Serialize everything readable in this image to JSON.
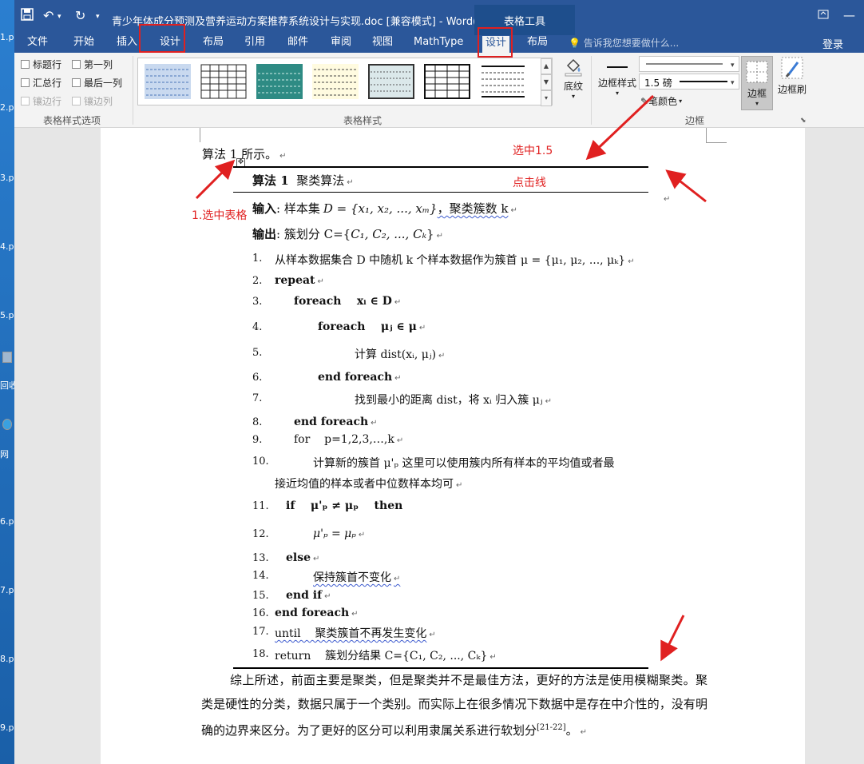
{
  "desktop": {
    "labels": [
      "1.p",
      "2.p",
      "3.p",
      "4.p",
      "5.p",
      "回收",
      "网",
      "6.p",
      "7.p",
      "8.p",
      "9.p"
    ]
  },
  "titlebar": {
    "title": "青少年体成分预测及营养运动方案推荐系统设计与实现.doc [兼容模式] - Word(...",
    "context_group": "表格工具",
    "icons": [
      "save-icon",
      "undo-icon",
      "redo-icon",
      "customize-icon",
      "restore-icon",
      "minimize-icon"
    ]
  },
  "tabs": [
    {
      "label": "文件"
    },
    {
      "label": "开始"
    },
    {
      "label": "插入"
    },
    {
      "label": "设计"
    },
    {
      "label": "布局"
    },
    {
      "label": "引用"
    },
    {
      "label": "邮件"
    },
    {
      "label": "审阅"
    },
    {
      "label": "视图"
    },
    {
      "label": "MathType"
    },
    {
      "label": "设计"
    },
    {
      "label": "布局"
    }
  ],
  "tell_me": "告诉我您想要做什么...",
  "login": "登录",
  "ribbon": {
    "style_options": {
      "label": "表格样式选项",
      "items": [
        {
          "label": "标题行",
          "enabled": true
        },
        {
          "label": "第一列",
          "enabled": true
        },
        {
          "label": "汇总行",
          "enabled": true
        },
        {
          "label": "最后一列",
          "enabled": true
        },
        {
          "label": "镶边行",
          "enabled": false
        },
        {
          "label": "镶边列",
          "enabled": false
        }
      ]
    },
    "table_styles": {
      "label": "表格样式"
    },
    "shading": {
      "label": "底纹"
    },
    "borders_group": {
      "label": "边框",
      "border_styles_label": "边框样式",
      "weight_value": "1.5 磅",
      "pen_color_label": "笔颜色",
      "borders_label": "边框",
      "border_painter_label": "边框刷"
    }
  },
  "annotations": {
    "select_table": "1.选中表格",
    "select_15": "选中1.5",
    "click_line": "点击线"
  },
  "document": {
    "intro_line": "算法 1 所示。",
    "algo_title": {
      "num": "算法 1",
      "name": "聚类算法"
    },
    "input": {
      "label": "输入",
      "text": ": 样本集",
      "math": "D = {x₁, x₂, ..., xₘ}",
      "tail": "，聚类簇数 k"
    },
    "output": {
      "label": "输出",
      "text": ": 簇划分 C={",
      "math": "C₁, C₂, ..., Cₖ",
      "tail": "}"
    },
    "steps": [
      {
        "n": "1.",
        "text": "从样本数据集合 D 中随机 k 个样本数据作为簇首 μ = {μ₁, μ₂, ..., μₖ}"
      },
      {
        "n": "2.",
        "text": "repeat"
      },
      {
        "n": "3.",
        "text": "foreach    xᵢ ∈ D"
      },
      {
        "n": "4.",
        "text": "foreach    μⱼ ∈ μ"
      },
      {
        "n": "5.",
        "text": "计算 dist(xᵢ, μⱼ)"
      },
      {
        "n": "6.",
        "text": "end foreach"
      },
      {
        "n": "7.",
        "text": "找到最小的距离 dist，将 xᵢ 归入簇 μⱼ"
      },
      {
        "n": "8.",
        "text": "end foreach"
      },
      {
        "n": "9.",
        "text": "for    p=1,2,3,…,k"
      },
      {
        "n": "10.",
        "text": "计算新的簇首 μ'ₚ 这里可以使用簇内所有样本的平均值或者最"
      },
      {
        "n": "",
        "text": "接近均值的样本或者中位数样本均可"
      },
      {
        "n": "11.",
        "text": "if    μ'ₚ ≠ μₚ    then"
      },
      {
        "n": "12.",
        "text": "μ'ₚ = μₚ"
      },
      {
        "n": "13.",
        "text": "else"
      },
      {
        "n": "14.",
        "text": "保持簇首不变化"
      },
      {
        "n": "15.",
        "text": "end if"
      },
      {
        "n": "16.",
        "text": "end foreach"
      },
      {
        "n": "17.",
        "text": "until    聚类簇首不再发生变化"
      },
      {
        "n": "18.",
        "text": "return    簇划分结果 C={C₁, C₂, ..., Cₖ}"
      }
    ],
    "body_paragraph": "综上所述，前面主要是聚类，但是聚类并不是最佳方法，更好的方法是使用模糊聚类。聚类是硬性的分类，数据只属于一个类别。而实际上在很多情况下数据中是存在中介性的，没有明确的边界来区分。为了更好的区分可以利用隶属关系进行软划分",
    "citation": "[21-22]",
    "body_end": "。"
  }
}
